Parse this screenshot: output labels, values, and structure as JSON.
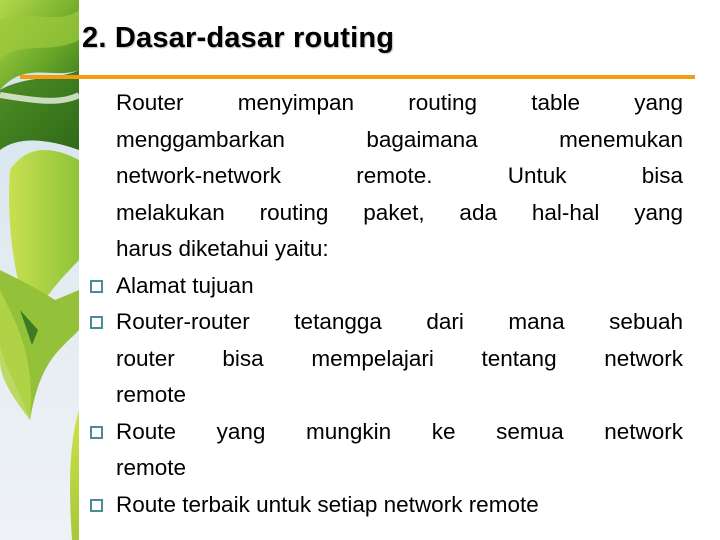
{
  "slide": {
    "title": "2. Dasar-dasar routing",
    "accent_color": "#f39c12",
    "bullet_color": "#4a8c95",
    "intro_lines": [
      "Router menyimpan routing table yang",
      "menggambarkan bagaimana menemukan",
      "network-network remote.    Untuk bisa",
      "melakukan routing paket, ada hal-hal yang",
      "harus diketahui yaitu:"
    ],
    "bullets": [
      {
        "icon": "square-bullet-icon",
        "lines": [
          "Alamat tujuan"
        ]
      },
      {
        "icon": "square-bullet-icon",
        "lines": [
          "Router-router tetangga dari mana sebuah",
          "router bisa mempelajari tentang network",
          "remote"
        ]
      },
      {
        "icon": "square-bullet-icon",
        "lines": [
          "Route yang mungkin ke semua network",
          "remote"
        ]
      },
      {
        "icon": "square-bullet-icon",
        "lines": [
          "Route terbaik untuk setiap network remote"
        ]
      }
    ]
  }
}
